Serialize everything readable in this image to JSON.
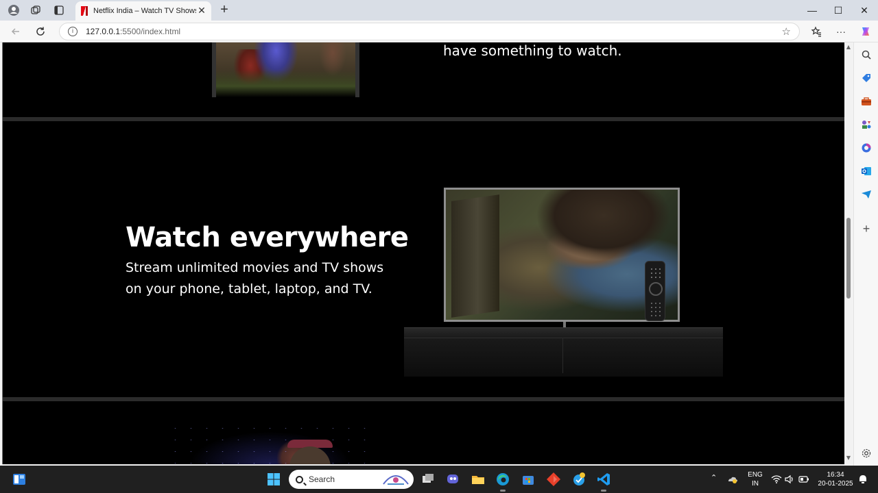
{
  "browser": {
    "tab_title": "Netflix India – Watch TV Shows O",
    "new_tab": "+",
    "close_tab": "✕",
    "address_host": "127.0.0.1",
    "address_path": ":5500/index.html",
    "window_controls": {
      "minimize": "—",
      "maximize": "☐",
      "close": "✕"
    },
    "more_menu": "···"
  },
  "page": {
    "prev_section_tail": "have something to watch.",
    "watch_heading": "Watch everywhere",
    "watch_line1": "Stream unlimited movies and TV shows",
    "watch_line2": "on your phone, tablet, laptop, and TV."
  },
  "taskbar": {
    "search_label": "Search",
    "language_top": "ENG",
    "language_bottom": "IN",
    "time": "16:34",
    "date": "20-01-2025"
  },
  "colors": {
    "page_bg": "#000000",
    "divider": "#2b2b2b",
    "netflix_red": "#e50914",
    "taskbar_bg": "#202020"
  },
  "icons": [
    "profile-icon",
    "collections-icon",
    "tab-actions-icon",
    "back-icon",
    "refresh-icon",
    "info-icon",
    "favorite-star-icon",
    "favorites-icon",
    "copilot-icon",
    "search-sidebar-icon",
    "shopping-icon",
    "tools-icon",
    "games-icon",
    "office-icon",
    "outlook-icon",
    "send-icon",
    "add-icon",
    "settings-icon",
    "windows-start-icon",
    "task-view-icon",
    "chat-icon",
    "explorer-icon",
    "edge-icon",
    "store-icon",
    "office-app-icon",
    "vscode-icon",
    "wifi-icon",
    "volume-icon",
    "battery-icon",
    "notification-icon"
  ]
}
